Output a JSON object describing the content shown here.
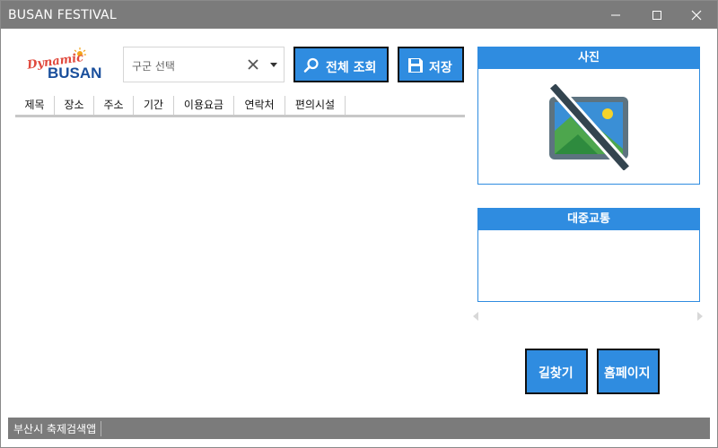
{
  "window": {
    "title": "BUSAN FESTIVAL",
    "minimize_icon": "minimize-icon",
    "maximize_icon": "maximize-icon",
    "close_icon": "close-icon"
  },
  "logo": {
    "line1": "Dynamic",
    "line2": "BUSAN",
    "colors": {
      "line1": "#e0483c",
      "line2": "#1a4f9c",
      "sun": "#f3a51b"
    }
  },
  "district_combo": {
    "placeholder": "구군 선택",
    "clear_icon": "clear-icon",
    "dropdown_icon": "chevron-down-icon"
  },
  "toolbar": {
    "search_all_label": "전체 조회",
    "search_icon": "search-icon",
    "save_label": "저장",
    "save_icon": "floppy-disk-icon"
  },
  "grid": {
    "columns": [
      "제목",
      "장소",
      "주소",
      "기간",
      "이용요금",
      "연락처",
      "편의시설"
    ],
    "rows": []
  },
  "photo_panel": {
    "title": "사진",
    "placeholder_icon": "no-image-icon"
  },
  "transit_panel": {
    "title": "대중교통",
    "prev_icon": "chevron-left-icon",
    "next_icon": "chevron-right-icon"
  },
  "actions": {
    "directions_label": "길찾기",
    "homepage_label": "홈페이지"
  },
  "status": {
    "text": "부산시 축제검색앱"
  },
  "colors": {
    "accent": "#2f8ce0",
    "titlebar": "#7b7b7b",
    "statusbar": "#7b7b7b"
  }
}
